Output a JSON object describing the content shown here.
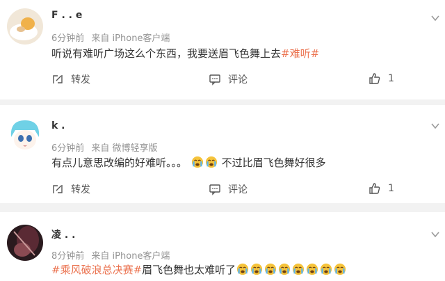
{
  "comments": [
    {
      "username": "F . . e",
      "time": "6分钟前",
      "source": "来自 iPhone客户端",
      "text_before": "听说有难听广场这么个东西，我要送眉飞色舞上去",
      "topic": "#难听#",
      "repost_label": "转发",
      "comment_label": "评论",
      "like_count": "1"
    },
    {
      "username": "k .",
      "time": "6分钟前",
      "source": "来自 微博轻享版",
      "text_before": "有点儿意思改编的好难听。。。",
      "text_after": "不过比眉飞色舞好很多",
      "repost_label": "转发",
      "comment_label": "评论",
      "like_count": "1"
    },
    {
      "username": "凌 . .",
      "time": "8分钟前",
      "source": "来自 iPhone客户端",
      "topic": "#乘风破浪总决赛#",
      "text_after": "眉飞色舞也太难听了"
    }
  ],
  "icons": {
    "more": "chevron-down-icon",
    "repost": "repost-icon",
    "comment": "comment-icon",
    "like": "thumbs-up-icon",
    "cry_emoji": "crying-face-emoji"
  },
  "colors": {
    "topic": "#eb7350",
    "meta": "#939393",
    "text": "#333333",
    "background": "#f2f2f2",
    "emoji": "#f5c33b"
  }
}
